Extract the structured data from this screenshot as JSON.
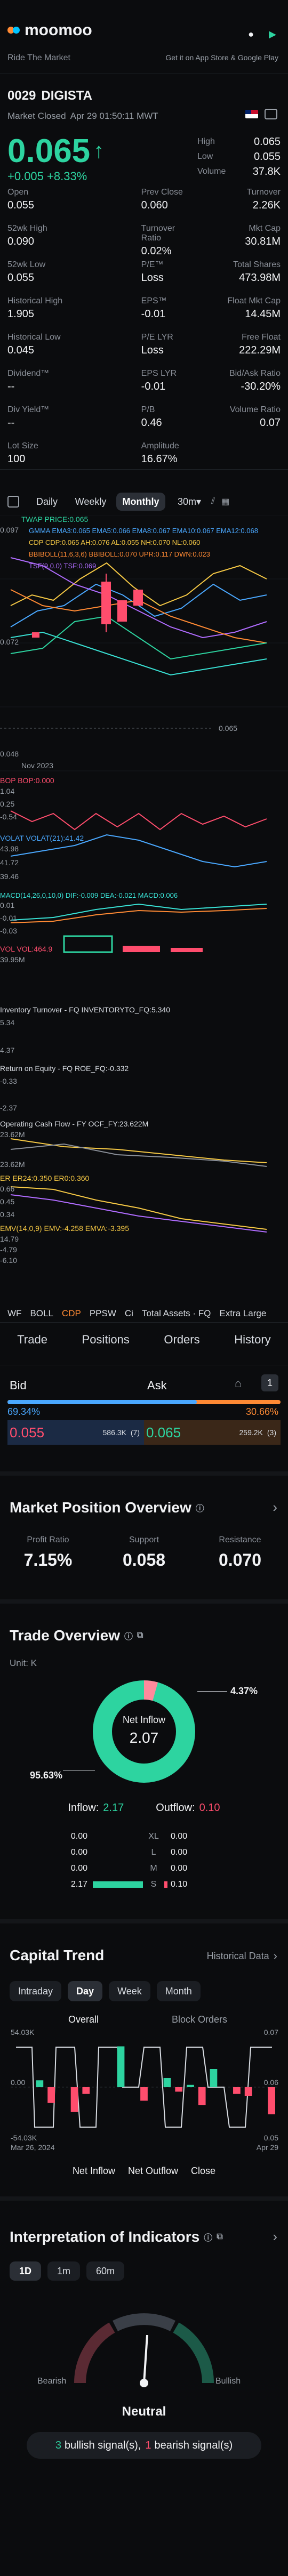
{
  "brand": {
    "name": "moomoo",
    "tagline": "Ride The Market",
    "store_text": "Get it on App Store & Google Play"
  },
  "ticker": {
    "code": "0029",
    "name": "DIGISTA",
    "status": "Market Closed",
    "date": "Apr 29 01:50:11 MWT"
  },
  "quote": {
    "price": "0.065",
    "change": "+0.005 +8.33%",
    "high_label": "High",
    "high": "0.065",
    "low_label": "Low",
    "low": "0.055",
    "volume_label": "Volume",
    "volume": "37.8K"
  },
  "stats": [
    {
      "label": "Open",
      "value": "0.055"
    },
    {
      "label": "Prev Close",
      "value": "0.060"
    },
    {
      "label": "Turnover",
      "value": "2.26K"
    },
    {
      "label": "52wk High",
      "value": "0.090"
    },
    {
      "label": "Turnover Ratio",
      "value": "0.02%"
    },
    {
      "label": "Mkt Cap",
      "value": "30.81M"
    },
    {
      "label": "52wk Low",
      "value": "0.055"
    },
    {
      "label": "P/E™",
      "value": "Loss"
    },
    {
      "label": "Total Shares",
      "value": "473.98M"
    },
    {
      "label": "Historical High",
      "value": "1.905"
    },
    {
      "label": "EPS™",
      "value": "-0.01"
    },
    {
      "label": "Float Mkt Cap",
      "value": "14.45M"
    },
    {
      "label": "Historical Low",
      "value": "0.045"
    },
    {
      "label": "P/E LYR",
      "value": "Loss"
    },
    {
      "label": "Free Float",
      "value": "222.29M"
    },
    {
      "label": "Dividend™",
      "value": "--"
    },
    {
      "label": "EPS LYR",
      "value": "-0.01"
    },
    {
      "label": "Bid/Ask Ratio",
      "value": "-30.20%"
    },
    {
      "label": "Div Yield™",
      "value": "--"
    },
    {
      "label": "P/B",
      "value": "0.46"
    },
    {
      "label": "Volume Ratio",
      "value": "0.07"
    },
    {
      "label": "Lot Size",
      "value": "100"
    },
    {
      "label": "Amplitude",
      "value": "16.67%"
    }
  ],
  "chart_tabs": {
    "daily": "Daily",
    "weekly": "Weekly",
    "monthly": "Monthly",
    "interval": "30m"
  },
  "chart": {
    "twap": "TWAP PRICE:0.065",
    "gmma": "GMMA EMA3:0.065 EMA5:0.066 EMA8:0.067 EMA10:0.067 EMA12:0.068",
    "cdp": "CDP CDP:0.065 AH:0.076 AL:0.055 NH:0.070 NL:0.060",
    "bbi": "BBIBOLL(11,6,3,6) BBIBOLL:0.070 UPR:0.117 DWN:0.023",
    "tsf": "TSF(9,0.0) TSF:0.069",
    "top_price": "0.097",
    "mid_price": "0.072",
    "low_price": "0.048",
    "last_price": "0.065",
    "date": "Nov 2023",
    "bop": "BOP BOP:0.000",
    "bop_vals": [
      "1.04",
      "0.25",
      "-0.54"
    ],
    "volat": "VOLAT VOLAT(21):41.42",
    "volat_vals": [
      "43.98",
      "41.72",
      "39.46"
    ],
    "macd": "MACD(14,26,0,10,0) DIF:-0.009 DEA:-0.021 MACD:0.006",
    "macd_vals": [
      "0.01",
      "-0.01",
      "-0.03"
    ],
    "vol": "VOL VOL:464.9",
    "vol_val": "39.95M",
    "inv": "Inventory Turnover - FQ INVENTORYTO_FQ:5.340",
    "inv_vals": [
      "5.34",
      "4.37"
    ],
    "roe": "Return on Equity - FQ ROE_FQ:-0.332",
    "roe_vals": [
      "-0.33",
      "-2.37"
    ],
    "ocf": "Operating Cash Flow - FY OCF_FY:23.622M",
    "ocf_vals": [
      "23.62M",
      "23.62M"
    ],
    "er": "ER ER24:0.350 ER0:0.360",
    "er_vals": [
      "0.66",
      "0.45",
      "0.34"
    ],
    "emv": "EMV(14,0,9) EMV:-4.258 EMVA:-3.395",
    "emv_vals": [
      "14.79",
      "-4.79",
      "-6.10"
    ],
    "bottom_tabs": [
      "WF",
      "BOLL",
      "CDP",
      "PPSW",
      "Ci",
      "Total Assets · FQ",
      "Extra Large"
    ]
  },
  "nav": {
    "trade": "Trade",
    "positions": "Positions",
    "orders": "Orders",
    "history": "History"
  },
  "bidask": {
    "bid_label": "Bid",
    "ask_label": "Ask",
    "bid_pct": "69.34%",
    "ask_pct": "30.66%",
    "bid_price": "0.055",
    "bid_size": "586.3K",
    "bid_count": "(7)",
    "ask_price": "0.065",
    "ask_size": "259.2K",
    "ask_count": "(3)",
    "counter": "1"
  },
  "position": {
    "title": "Market Position Overview",
    "profit_label": "Profit Ratio",
    "profit": "7.15%",
    "support_label": "Support",
    "support": "0.058",
    "resistance_label": "Resistance",
    "resistance": "0.070"
  },
  "trade": {
    "title": "Trade Overview",
    "unit": "Unit: K",
    "center_label": "Net Inflow",
    "center_value": "2.07",
    "pct_small": "4.37%",
    "pct_large": "95.63%",
    "inflow_label": "Inflow:",
    "inflow": "2.17",
    "outflow_label": "Outflow:",
    "outflow": "0.10",
    "rows": [
      {
        "l": "0.00",
        "s": "XL",
        "r": "0.00"
      },
      {
        "l": "0.00",
        "s": "L",
        "r": "0.00"
      },
      {
        "l": "0.00",
        "s": "M",
        "r": "0.00"
      },
      {
        "l": "2.17",
        "s": "S",
        "r": "0.10"
      }
    ],
    "donut": {
      "inflow_fraction": 0.9563,
      "outflow_fraction": 0.0437
    }
  },
  "capital": {
    "title": "Capital Trend",
    "link": "Historical Data",
    "tabs": [
      "Intraday",
      "Day",
      "Week",
      "Month"
    ],
    "overall": "Overall",
    "block": "Block Orders",
    "ytop": "54.03K",
    "ymid": "0.00",
    "ybot": "-54.03K",
    "rtop": "0.07",
    "rmid": "0.06",
    "rbot": "0.05",
    "dleft": "Mar 26, 2024",
    "dright": "Apr 29",
    "leg1": "Net Inflow",
    "leg2": "Net Outflow",
    "leg3": "Close",
    "bars": [
      0,
      0,
      0.15,
      -0.35,
      0,
      -0.55,
      -0.15,
      0,
      0,
      0.9,
      0,
      -0.3,
      0,
      0.2,
      -0.1,
      0.05,
      -0.4,
      0.4,
      0,
      -0.15,
      -0.2,
      0,
      -0.6
    ]
  },
  "indicators": {
    "title": "Interpretation of Indicators",
    "tabs": [
      "1D",
      "1m",
      "60m"
    ],
    "bearish": "Bearish",
    "bullish": "Bullish",
    "state": "Neutral",
    "bull_count": "3",
    "bull_text": "bullish signal(s),",
    "bear_count": "1",
    "bear_text": "bearish signal(s)"
  }
}
